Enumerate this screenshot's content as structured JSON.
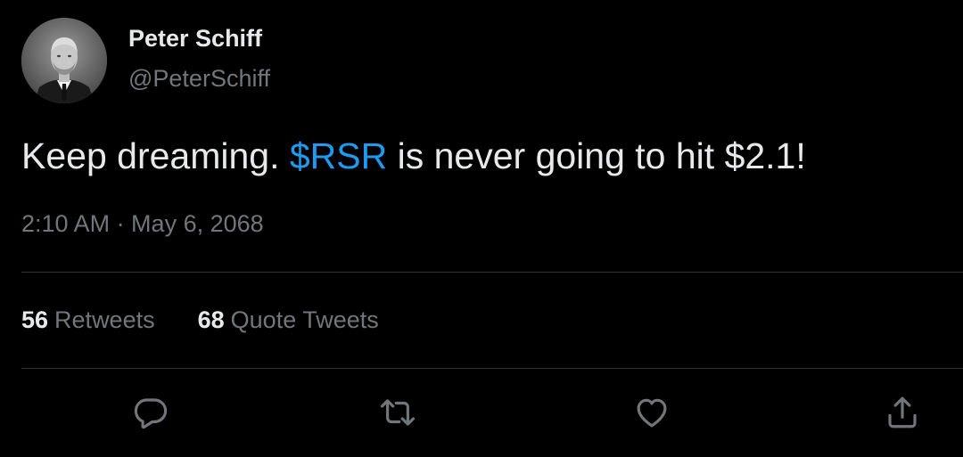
{
  "author": {
    "display_name": "Peter Schiff",
    "handle": "@PeterSchiff"
  },
  "tweet": {
    "text_before": "Keep dreaming. ",
    "cashtag": "$RSR",
    "text_after": " is never going to hit $2.1!",
    "timestamp": "2:10 AM · May 6, 2068"
  },
  "stats": {
    "retweets_count": "56",
    "retweets_label": "Retweets",
    "quotes_count": "68",
    "quotes_label": "Quote Tweets"
  },
  "actions": {
    "reply_icon": "reply-icon",
    "retweet_icon": "retweet-icon",
    "like_icon": "like-icon",
    "share_icon": "share-icon"
  },
  "colors": {
    "background": "#000000",
    "text": "#e7e9ea",
    "secondary_text": "#71767b",
    "link": "#1d9bf0",
    "divider": "#2f3336"
  }
}
